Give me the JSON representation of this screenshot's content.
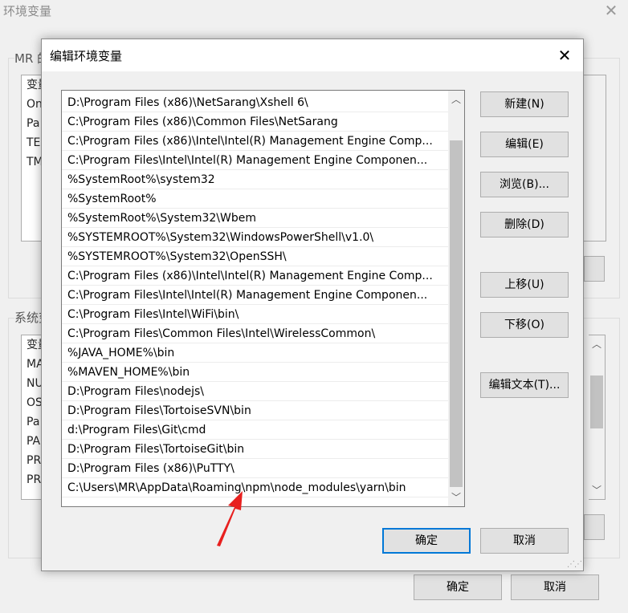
{
  "background_window": {
    "title": "环境变量",
    "user_group_label": "MR 的",
    "user_list_rows": [
      "变量",
      "On",
      "Pa",
      "TE",
      "TM"
    ],
    "system_group_label": "系统变",
    "system_list_rows": [
      "变量",
      "MA",
      "NU",
      "OS",
      "Pa",
      "PA",
      "PR",
      "PR"
    ],
    "ok_label": "确定",
    "cancel_label": "取消"
  },
  "dialog": {
    "title": "编辑环境变量",
    "close_glyph": "✕",
    "paths": [
      "D:\\Program Files (x86)\\NetSarang\\Xshell 6\\",
      "C:\\Program Files (x86)\\Common Files\\NetSarang",
      "C:\\Program Files (x86)\\Intel\\Intel(R) Management Engine Comp...",
      "C:\\Program Files\\Intel\\Intel(R) Management Engine Componen...",
      "%SystemRoot%\\system32",
      "%SystemRoot%",
      "%SystemRoot%\\System32\\Wbem",
      "%SYSTEMROOT%\\System32\\WindowsPowerShell\\v1.0\\",
      "%SYSTEMROOT%\\System32\\OpenSSH\\",
      "C:\\Program Files (x86)\\Intel\\Intel(R) Management Engine Comp...",
      "C:\\Program Files\\Intel\\Intel(R) Management Engine Componen...",
      "C:\\Program Files\\Intel\\WiFi\\bin\\",
      "C:\\Program Files\\Common Files\\Intel\\WirelessCommon\\",
      "%JAVA_HOME%\\bin",
      "%MAVEN_HOME%\\bin",
      "D:\\Program Files\\nodejs\\",
      "D:\\Program Files\\TortoiseSVN\\bin",
      "d:\\Program Files\\Git\\cmd",
      "D:\\Program Files\\TortoiseGit\\bin",
      "D:\\Program Files (x86)\\PuTTY\\",
      "C:\\Users\\MR\\AppData\\Roaming\\npm\\node_modules\\yarn\\bin"
    ],
    "buttons": {
      "new": "新建(N)",
      "edit": "编辑(E)",
      "browse": "浏览(B)...",
      "delete": "删除(D)",
      "move_up": "上移(U)",
      "move_down": "下移(O)",
      "edit_text": "编辑文本(T)...",
      "ok": "确定",
      "cancel": "取消"
    }
  },
  "colors": {
    "accent": "#0078d7",
    "annotation_arrow": "#e8201f"
  }
}
